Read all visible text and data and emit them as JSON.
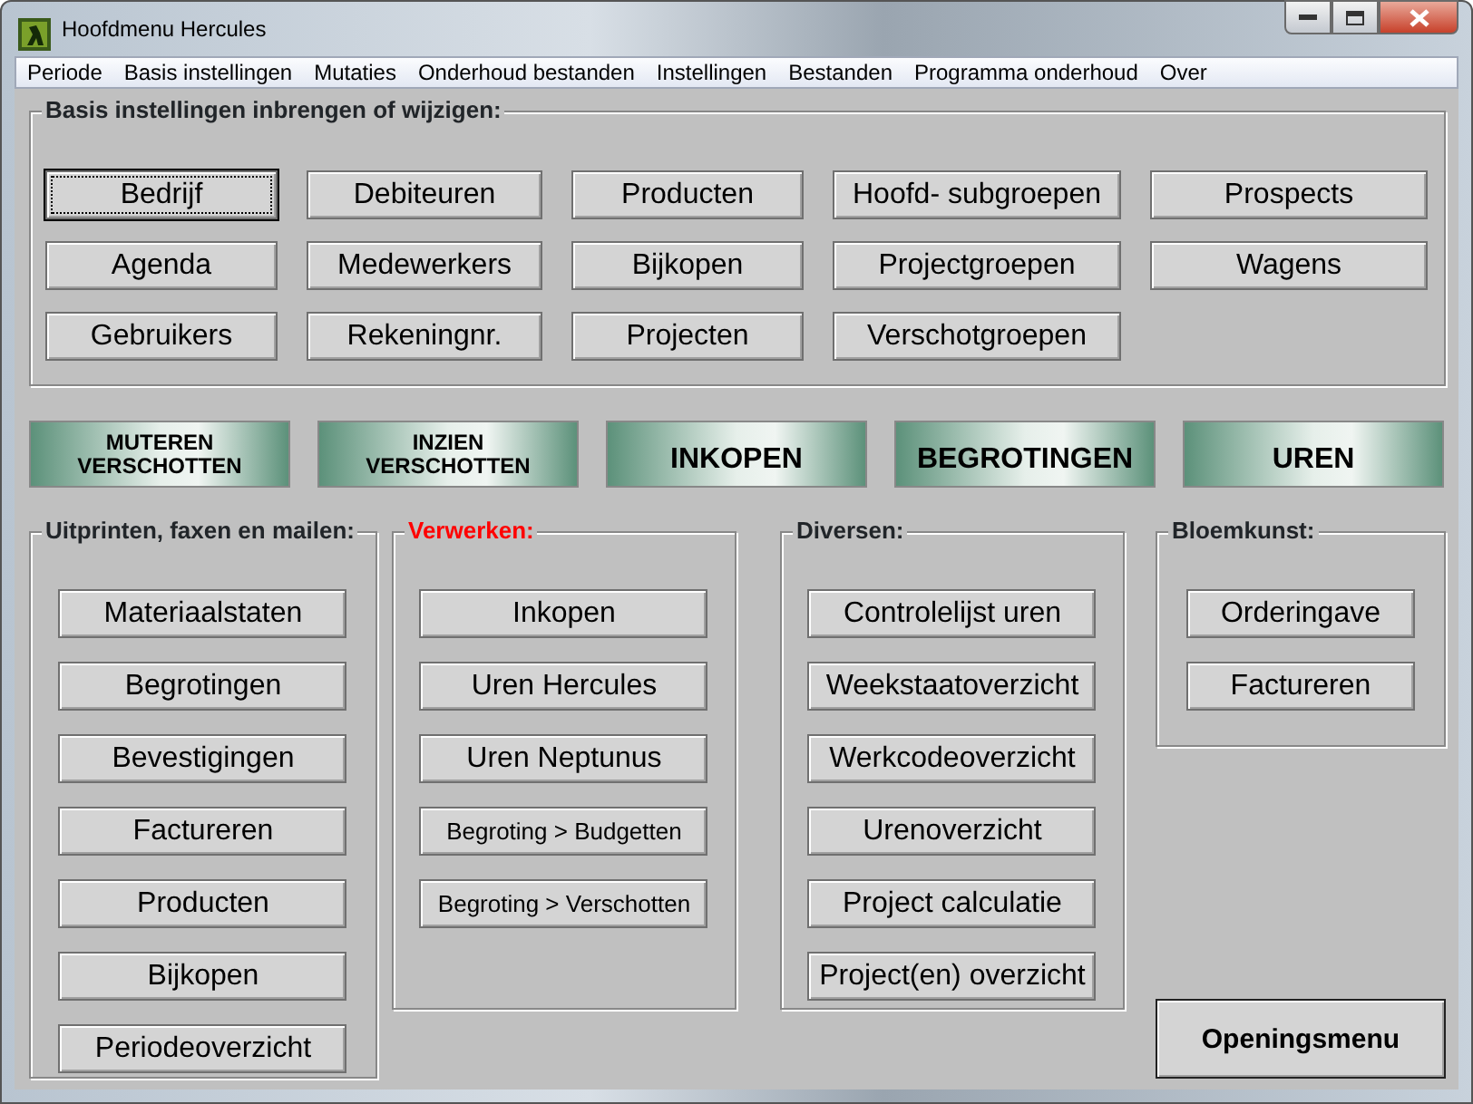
{
  "window": {
    "title": "Hoofdmenu Hercules"
  },
  "menu": [
    "Periode",
    "Basis instellingen",
    "Mutaties",
    "Onderhoud bestanden",
    "Instellingen",
    "Bestanden",
    "Programma onderhoud",
    "Over"
  ],
  "basis": {
    "title": "Basis instellingen inbrengen of wijzigen:",
    "columns": [
      [
        {
          "label": "Bedrijf",
          "focused": true
        },
        {
          "label": "Agenda",
          "focused": false
        },
        {
          "label": "Gebruikers",
          "focused": false
        }
      ],
      [
        {
          "label": "Debiteuren",
          "focused": false
        },
        {
          "label": "Medewerkers",
          "focused": false
        },
        {
          "label": "Rekeningnr.",
          "focused": false
        }
      ],
      [
        {
          "label": "Producten",
          "focused": false
        },
        {
          "label": "Bijkopen",
          "focused": false
        },
        {
          "label": "Projecten",
          "focused": false
        }
      ],
      [
        {
          "label": "Hoofd- subgroepen",
          "focused": false
        },
        {
          "label": "Projectgroepen",
          "focused": false
        },
        {
          "label": "Verschotgroepen",
          "focused": false
        }
      ],
      [
        {
          "label": "Prospects",
          "focused": false
        },
        {
          "label": "Wagens",
          "focused": false
        }
      ]
    ]
  },
  "action_buttons": [
    {
      "label": "MUTEREN VERSCHOTTEN",
      "kind": "two-line"
    },
    {
      "label": "INZIEN VERSCHOTTEN",
      "kind": "two-line"
    },
    {
      "label": "INKOPEN",
      "kind": "large"
    },
    {
      "label": "BEGROTINGEN",
      "kind": "large"
    },
    {
      "label": "UREN",
      "kind": "large"
    }
  ],
  "groups": [
    {
      "title": "Uitprinten, faxen en mailen:",
      "highlight": false,
      "buttons": [
        {
          "label": "Materiaalstaten",
          "kind": "normal"
        },
        {
          "label": "Begrotingen",
          "kind": "normal"
        },
        {
          "label": "Bevestigingen",
          "kind": "normal"
        },
        {
          "label": "Factureren",
          "kind": "normal"
        },
        {
          "label": "Producten",
          "kind": "normal"
        },
        {
          "label": "Bijkopen",
          "kind": "normal"
        },
        {
          "label": "Periodeoverzicht",
          "kind": "normal"
        }
      ]
    },
    {
      "title": "Verwerken:",
      "highlight": true,
      "buttons": [
        {
          "label": "Inkopen",
          "kind": "normal"
        },
        {
          "label": "Uren Hercules",
          "kind": "normal"
        },
        {
          "label": "Uren Neptunus",
          "kind": "normal"
        },
        {
          "label": "Begroting > Budgetten",
          "kind": "small"
        },
        {
          "label": "Begroting > Verschotten",
          "kind": "small"
        }
      ]
    },
    {
      "title": "Diversen:",
      "highlight": false,
      "buttons": [
        {
          "label": "Controlelijst uren",
          "kind": "normal"
        },
        {
          "label": "Weekstaatoverzicht",
          "kind": "normal"
        },
        {
          "label": "Werkcodeoverzicht",
          "kind": "normal"
        },
        {
          "label": "Urenoverzicht",
          "kind": "normal"
        },
        {
          "label": "Project calculatie",
          "kind": "normal"
        },
        {
          "label": "Project(en) overzicht",
          "kind": "normal"
        }
      ]
    },
    {
      "title": "Bloemkunst:",
      "highlight": false,
      "buttons": [
        {
          "label": "Orderingave",
          "kind": "normal"
        },
        {
          "label": "Factureren",
          "kind": "normal"
        }
      ]
    }
  ],
  "opening_button": {
    "label": "Openingsmenu"
  }
}
